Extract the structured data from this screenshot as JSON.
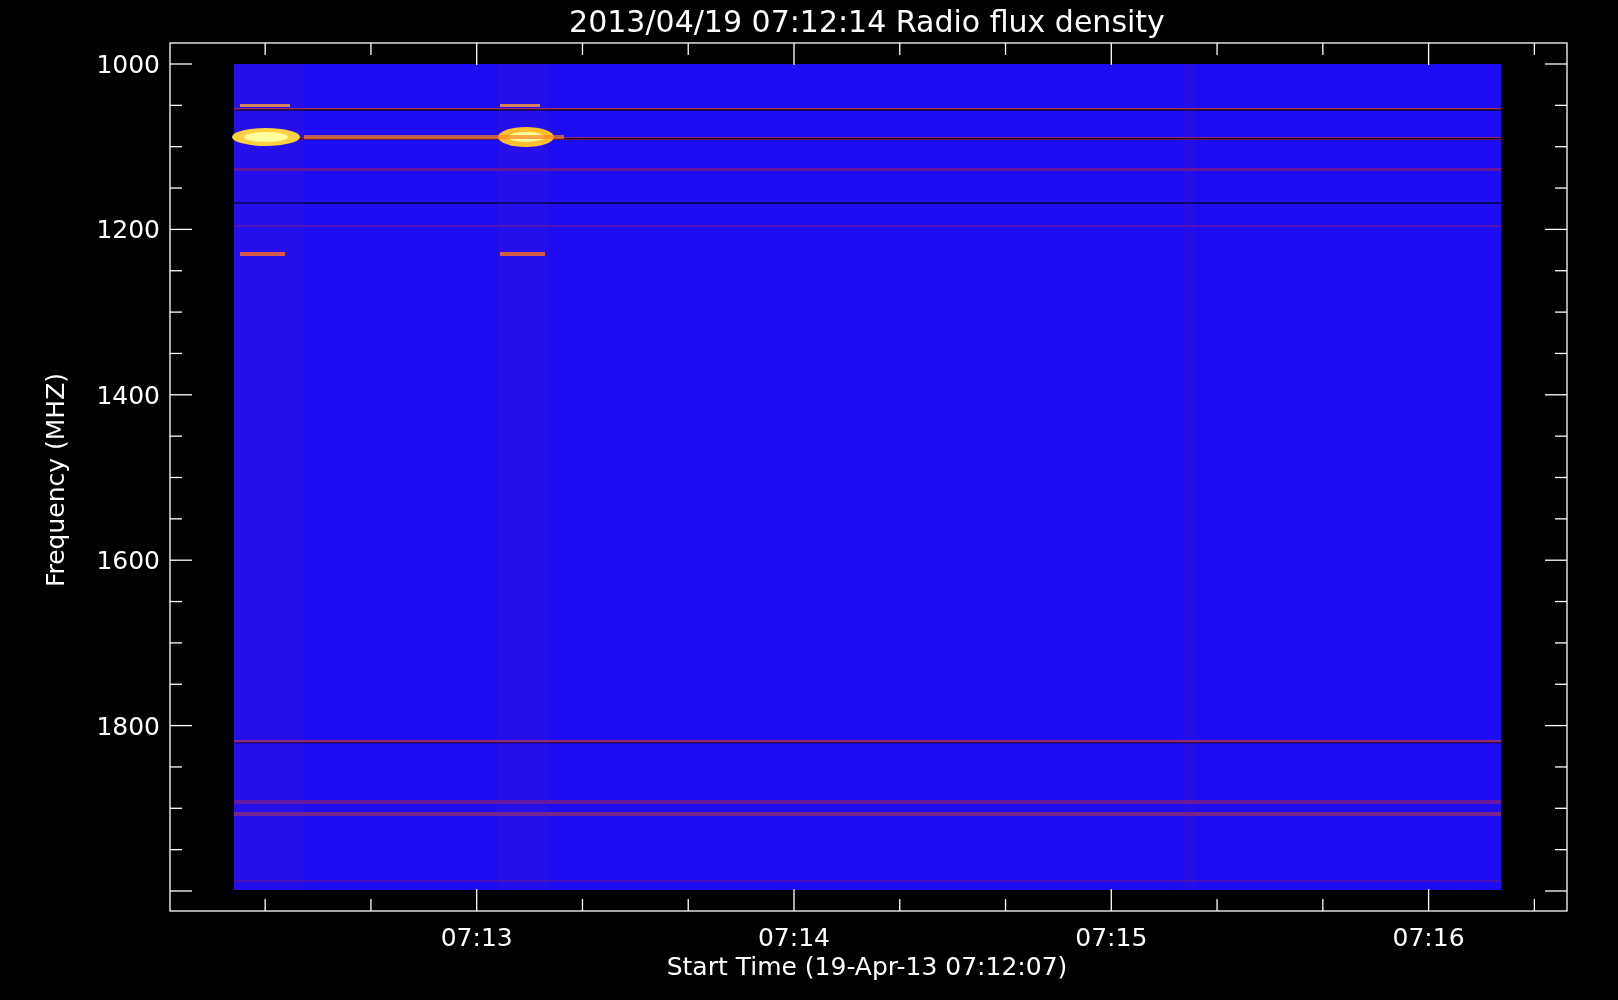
{
  "title": "2013/04/19 07:12:14 Radio flux density",
  "y_axis": {
    "label": "Frequency (MHZ)",
    "ticks": [
      "1000",
      "1200",
      "1400",
      "1600",
      "1800"
    ]
  },
  "x_axis": {
    "label": "Start Time (19-Apr-13 07:12:07)",
    "ticks": [
      "07:13",
      "07:14",
      "07:15",
      "07:16"
    ]
  }
}
